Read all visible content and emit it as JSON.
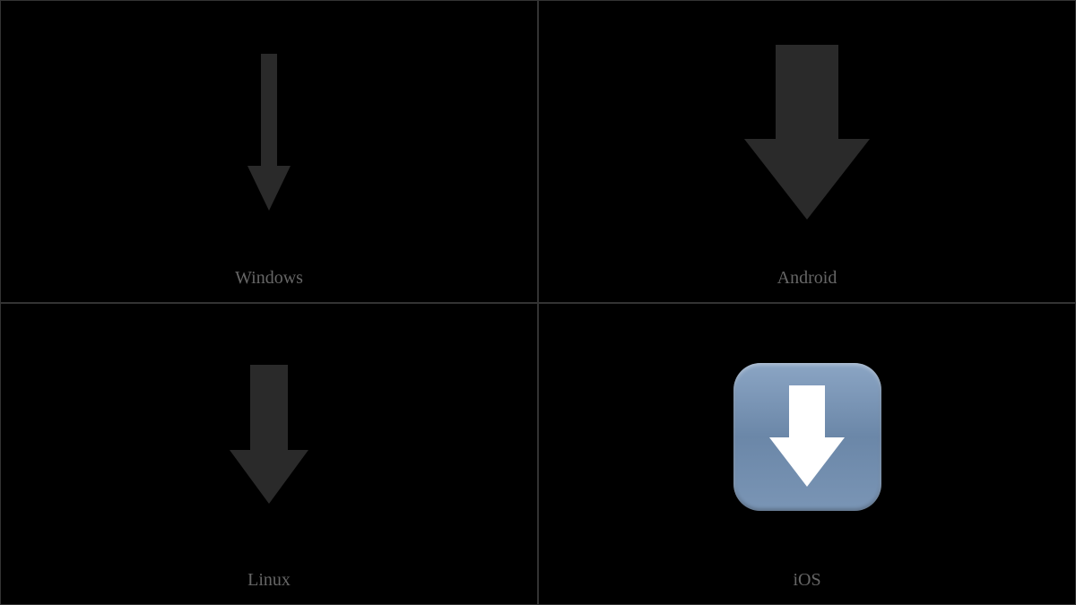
{
  "cells": [
    {
      "label": "Windows",
      "icon": "down-arrow"
    },
    {
      "label": "Android",
      "icon": "down-arrow"
    },
    {
      "label": "Linux",
      "icon": "down-arrow"
    },
    {
      "label": "iOS",
      "icon": "down-arrow"
    }
  ]
}
